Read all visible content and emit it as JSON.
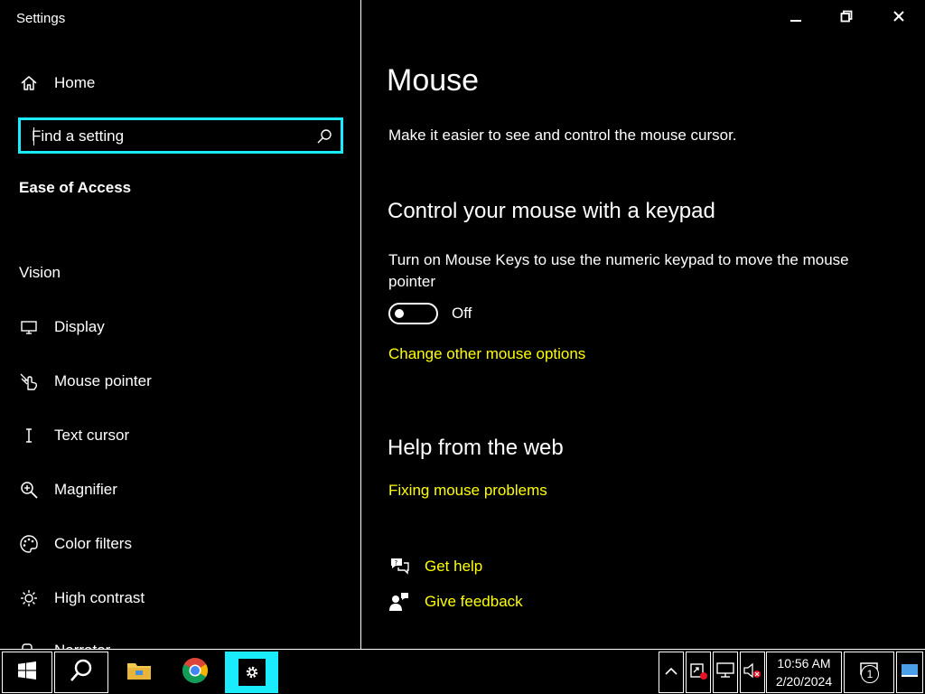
{
  "window": {
    "app_title": "Settings",
    "controls": [
      "minimize-icon",
      "restore-icon",
      "close-icon"
    ]
  },
  "sidebar": {
    "home_label": "Home",
    "search": {
      "placeholder": "Find a setting",
      "value": ""
    },
    "section_title": "Ease of Access",
    "group_title": "Vision",
    "items": [
      {
        "label": "Display",
        "icon": "display-icon"
      },
      {
        "label": "Mouse pointer",
        "icon": "mouse-pointer-icon"
      },
      {
        "label": "Text cursor",
        "icon": "text-cursor-icon"
      },
      {
        "label": "Magnifier",
        "icon": "magnifier-icon"
      },
      {
        "label": "Color filters",
        "icon": "color-filters-icon"
      },
      {
        "label": "High contrast",
        "icon": "high-contrast-icon"
      },
      {
        "label": "Narrator",
        "icon": "narrator-icon"
      }
    ]
  },
  "main": {
    "title": "Mouse",
    "description": "Make it easier to see and control the mouse cursor.",
    "keypad_heading": "Control your mouse with a keypad",
    "mouse_keys_desc": "Turn on Mouse Keys to use the numeric keypad to move the mouse pointer",
    "mouse_keys_state": "Off",
    "mouse_keys_on": false,
    "other_options_link": "Change other mouse options",
    "help_heading": "Help from the web",
    "help_link": "Fixing mouse problems",
    "get_help": "Get help",
    "give_feedback": "Give feedback"
  },
  "taskbar": {
    "clock_time": "10:56 AM",
    "clock_date": "2/20/2024",
    "notification_count": "1",
    "accent_color": "#1aebff",
    "link_color": "#ffff00"
  }
}
